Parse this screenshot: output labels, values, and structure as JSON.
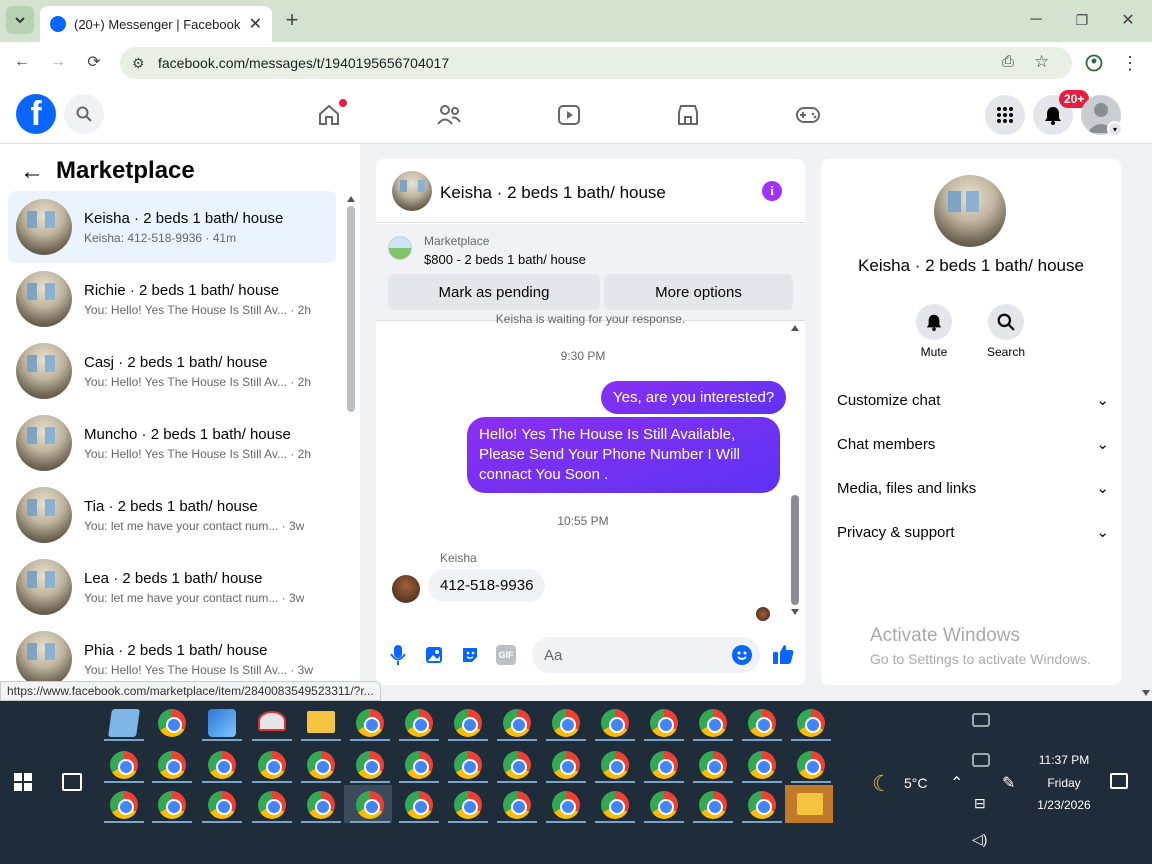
{
  "browser": {
    "tab_title": "(20+) Messenger | Facebook",
    "url": "facebook.com/messages/t/1940195656704017",
    "status_url": "https://www.facebook.com/marketplace/item/2840083549523311/?r..."
  },
  "header": {
    "notification_badge": "20+"
  },
  "left": {
    "title": "Marketplace",
    "conversations": [
      {
        "name": "Keisha · 2 beds 1 bath/ house",
        "preview": "Keisha: 412-518-9936 · 41m"
      },
      {
        "name": "Richie · 2 beds 1 bath/ house",
        "preview": "You: Hello! Yes The House Is Still Av... · 2h"
      },
      {
        "name": "Casj · 2 beds 1 bath/ house",
        "preview": "You: Hello! Yes The House Is Still Av... · 2h"
      },
      {
        "name": "Muncho · 2 beds 1 bath/ house",
        "preview": "You: Hello! Yes The House Is Still Av... · 2h"
      },
      {
        "name": "Tia · 2 beds 1 bath/ house",
        "preview": "You: let me have your contact num... · 3w"
      },
      {
        "name": "Lea · 2 beds 1 bath/ house",
        "preview": "You: let me have your contact num... · 3w"
      },
      {
        "name": "Phia · 2 beds 1 bath/ house",
        "preview": "You: Hello! Yes The House Is Still Av... · 3w"
      }
    ]
  },
  "chat": {
    "title": "Keisha · 2 beds 1 bath/ house",
    "listing_label": "Marketplace",
    "listing_price": "$800 - 2 beds 1 bath/ house",
    "mark_pending": "Mark as pending",
    "more_options": "More options",
    "waiting_text": "Keisha is waiting for your response.",
    "time1": "9:30 PM",
    "msg1": "Yes, are you interested?",
    "msg2": "Hello! Yes The House  Is Still Available, Please Send Your Phone Number I Will connact You Soon .",
    "time2": "10:55 PM",
    "sender": "Keisha",
    "msg3": "412-518-9936",
    "input_placeholder": "Aa"
  },
  "right": {
    "name": "Keisha · 2 beds 1 bath/ house",
    "mute": "Mute",
    "search": "Search",
    "menu": [
      "Customize chat",
      "Chat members",
      "Media, files and links",
      "Privacy & support"
    ],
    "activate_title": "Activate Windows",
    "activate_sub": "Go to Settings to activate Windows."
  },
  "taskbar": {
    "temperature": "5°C",
    "time": "11:37 PM",
    "day": "Friday",
    "date": "1/23/2026"
  },
  "colors": {
    "facebook_blue": "#0866ff",
    "messenger_purple": "#a033ff",
    "notification_red": "#e41e3f"
  }
}
